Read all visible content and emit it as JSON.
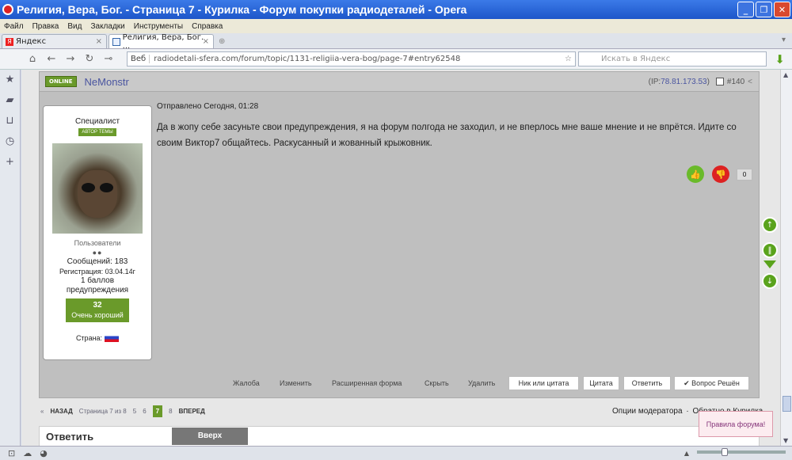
{
  "window": {
    "title": "Религия, Вера, Бог. - Страница 7 - Курилка - Форум покупки радиодеталей - Opera"
  },
  "menu": [
    "Файл",
    "Правка",
    "Вид",
    "Закладки",
    "Инструменты",
    "Справка"
  ],
  "tabs": [
    {
      "label": "Яндекс"
    },
    {
      "label": "Религия, Вера, Бог. ..."
    }
  ],
  "nav": {
    "web_label": "Веб",
    "url": "radiodetali-sfera.com/forum/topic/1131-religiia-vera-bog/page-7#entry62548",
    "search_placeholder": "Искать в Яндекс"
  },
  "post": {
    "online_badge": "ONLINE",
    "username": "NeMonstr",
    "ip_label": "(IP: ",
    "ip": "78.81.173.53",
    "ip_close": ")",
    "post_number": "#140",
    "meta": "Отправлено Сегодня, 01:28",
    "text": "Да в жопу себе засуньте свои предупреждения, я на форум полгода не заходил, и не вперлось мне ваше мнение и не впрётся. Идите со своим Виктор7 общайтесь. Раскусанный и жованный крыжовник.",
    "vote_count": "0"
  },
  "user": {
    "role": "Специалист",
    "author_badge": "АВТОР ТЕМЫ",
    "group": "Пользователи",
    "posts": "Сообщений: 183",
    "registered": "Регистрация: 03.04.14г",
    "warnings_value": "1 баллов",
    "warnings_label": "предупреждения",
    "rep_value": "32",
    "rep_label": "Очень хороший",
    "country_label": "Страна:"
  },
  "actions": {
    "complaint": "Жалоба",
    "edit": "Изменить",
    "extended": "Расширенная форма",
    "hide": "Скрыть",
    "delete": "Удалить",
    "nick_quote": "Ник или цитата",
    "quote": "Цитата",
    "reply": "Ответить",
    "solved": "✔ Вопрос Решён"
  },
  "pager": {
    "prev": "«",
    "back": "НАЗАД",
    "info": "Страница 7 из 8",
    "pages": [
      "5",
      "6",
      "7",
      "8"
    ],
    "current": "7",
    "next": "ВПЕРЕД"
  },
  "moderation": {
    "options": "Опции модератора",
    "back_link": "Обратно в Курилка"
  },
  "reply_box": {
    "title": "Ответить",
    "up_button": "Вверх"
  },
  "rules_tooltip": "Правила форума!",
  "colors": {
    "accent_green": "#6a9a2a",
    "title_bar": "#2a62d6",
    "link_purple": "#4a55a0"
  }
}
